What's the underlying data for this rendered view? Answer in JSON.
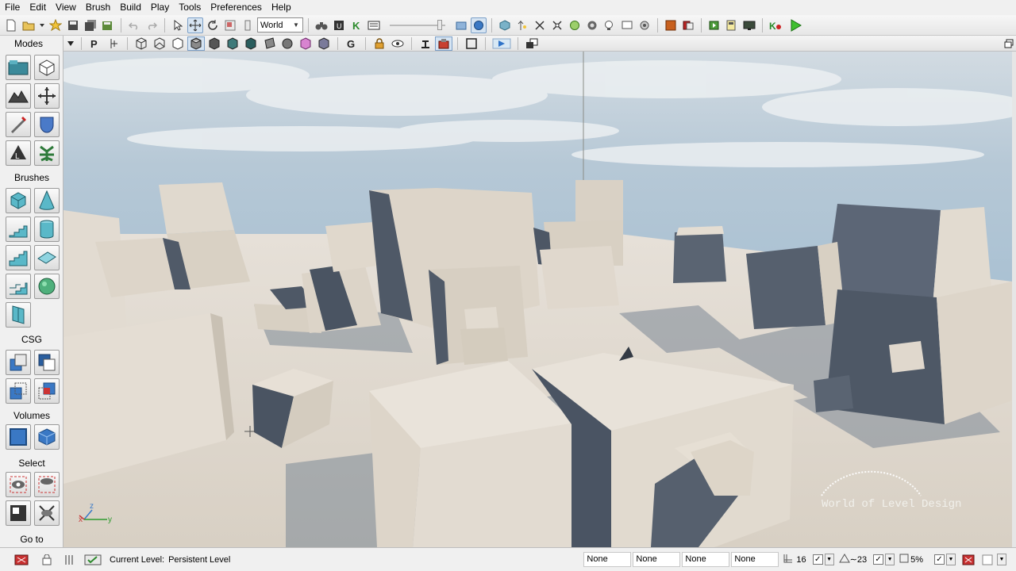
{
  "menu": [
    "File",
    "Edit",
    "View",
    "Brush",
    "Build",
    "Play",
    "Tools",
    "Preferences",
    "Help"
  ],
  "toolbar": {
    "coordinate_system": "World",
    "icons": [
      "new-icon",
      "open-icon",
      "open-dropdown-icon",
      "save-icon",
      "save-all-icon",
      "save-level-icon",
      "save-package-icon",
      "undo-icon",
      "redo-icon",
      "select-icon",
      "move-icon",
      "rotate-icon",
      "scale-icon",
      "non-uniform-scale-icon",
      "find-icon",
      "generic-browser-icon",
      "kismet-icon",
      "matinee-icon",
      "build-geometry-icon",
      "build-lighting-icon",
      "build-paths-icon",
      "build-all-icon",
      "lightmass-icon",
      "play-in-editor-icon",
      "play-on-pc-icon"
    ]
  },
  "modes_panel": {
    "title": "Modes",
    "sections": {
      "brushes": "Brushes",
      "csg": "CSG",
      "volumes": "Volumes",
      "select": "Select",
      "goto": "Go to"
    }
  },
  "viewport": {
    "axis_labels": {
      "x": "x",
      "y": "y",
      "z": "z"
    },
    "watermark": "World of Level Design"
  },
  "statusbar": {
    "current_level_label": "Current Level:",
    "current_level_value": "Persistent Level",
    "fields": [
      "None",
      "None",
      "None",
      "None"
    ],
    "grid_size": "16",
    "rotation_snap": "∼23",
    "scale_snap": "5%"
  },
  "colors": {
    "sky_top": "#b4c7d6",
    "sky_bottom": "#a9c2d4",
    "floor": "#ddd6cc",
    "block_light": "#d8d1c5",
    "block_shadow": "#4e5866",
    "accent_blue": "#2f73c8"
  }
}
